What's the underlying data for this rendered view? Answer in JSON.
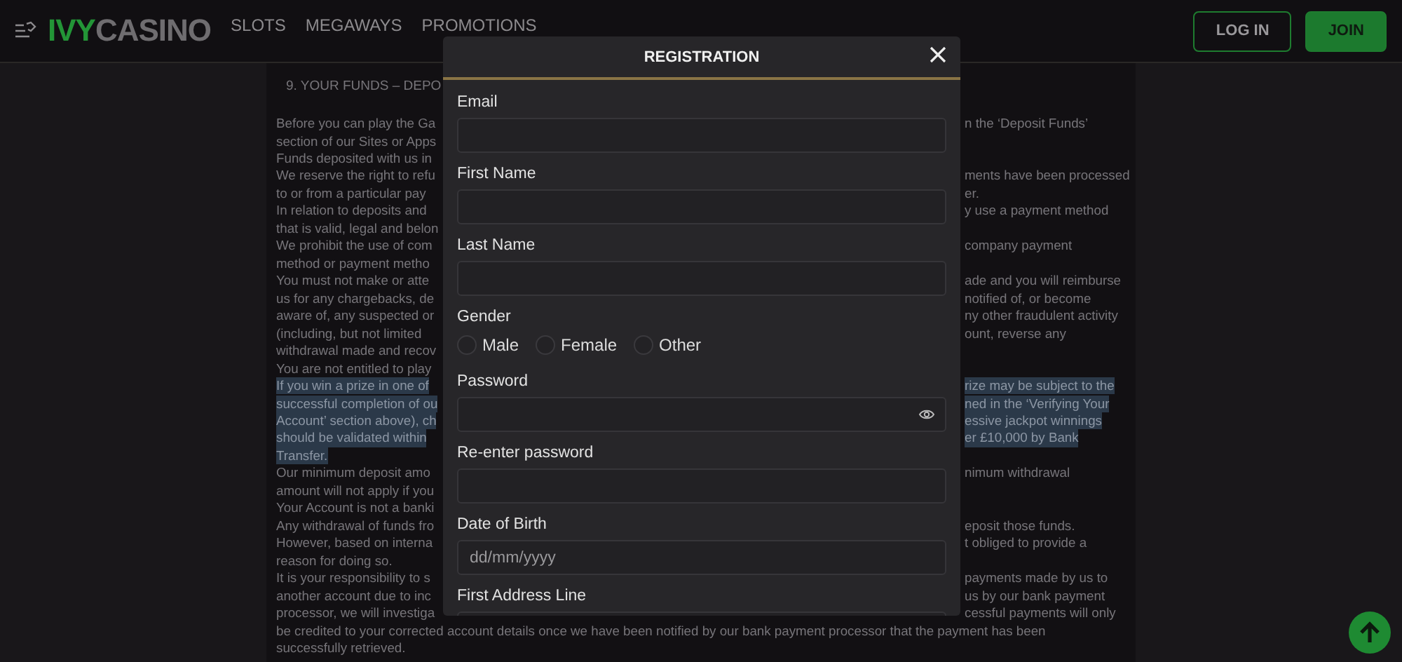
{
  "header": {
    "logo": {
      "accent": "IVY",
      "rest": "CASINO"
    },
    "nav": [
      "SLOTS",
      "MEGAWAYS",
      "PROMOTIONS"
    ],
    "buttons": [
      {
        "label": "LOG IN",
        "kind": "outline"
      },
      {
        "label": "JOIN",
        "kind": "filled"
      }
    ]
  },
  "document": {
    "heading": "9. YOUR FUNDS – DEPO",
    "lines": [
      {
        "left": "Before you can play the Ga",
        "right": "n the ‘Deposit Funds’",
        "highlighted": false
      },
      {
        "left": "section of our Sites or Apps",
        "highlighted": false
      },
      {
        "left": "Funds deposited with us in",
        "highlighted": false
      },
      {
        "left": "We reserve the right to refu",
        "right": "ments have been processed",
        "highlighted": false
      },
      {
        "left": "to or from a particular pay",
        "right": "er.",
        "highlighted": false
      },
      {
        "left": "In relation to deposits and",
        "right": "y use a payment method",
        "highlighted": false
      },
      {
        "left": "that is valid, legal and belon",
        "highlighted": false
      },
      {
        "left": "We prohibit the use of com",
        "right": "company payment",
        "highlighted": false
      },
      {
        "left": "method or payment metho",
        "highlighted": false
      },
      {
        "left": "You must not make or atte",
        "right": "ade and you will reimburse",
        "highlighted": false
      },
      {
        "left": "us for any chargebacks, de",
        "right": "notified of, or become",
        "highlighted": false
      },
      {
        "left": "aware of, any suspected or",
        "right": "ny other fraudulent activity",
        "highlighted": false
      },
      {
        "left": "(including, but not limited",
        "right": "ount, reverse any",
        "highlighted": false
      },
      {
        "left": "withdrawal made and recov",
        "highlighted": false
      },
      {
        "left": "You are not entitled to play",
        "highlighted": false
      },
      {
        "left": "If you win a prize in one of",
        "right": "rize may be subject to the",
        "highlighted": true
      },
      {
        "left": "successful completion of ou",
        "right": "ned in the ‘Verifying Your",
        "highlighted": true
      },
      {
        "left": "Account’ section above), ch",
        "right": "essive jackpot winnings",
        "highlighted": true
      },
      {
        "left": "should be validated within",
        "right": "er £10,000 by Bank",
        "highlighted": true
      },
      {
        "left": "Transfer.",
        "highlighted": true
      },
      {
        "left": "Our minimum deposit amo",
        "right": "nimum withdrawal",
        "highlighted": false
      },
      {
        "left": "amount will not apply if you",
        "highlighted": false
      },
      {
        "left": "Your Account is not a banki",
        "highlighted": false
      },
      {
        "left": "Any withdrawal of funds fro",
        "right": "eposit those funds.",
        "highlighted": false
      },
      {
        "left": "However, based on interna",
        "right": "t obliged to provide a",
        "highlighted": false
      },
      {
        "left": "reason for doing so.",
        "highlighted": false
      },
      {
        "left": "It is your responsibility to s",
        "right": "payments made by us to",
        "highlighted": false
      },
      {
        "left": "another account due to inc",
        "right": "us by our bank payment",
        "highlighted": false
      },
      {
        "left": "processor, we will investiga",
        "right": "cessful payments will only",
        "highlighted": false
      },
      {
        "text": "be credited to your corrected account details once we have been notified by our bank payment processor that the payment has been",
        "highlighted": false
      },
      {
        "text": "successfully retrieved.",
        "highlighted": false
      }
    ]
  },
  "modal": {
    "title": "REGISTRATION",
    "fields": [
      {
        "kind": "text",
        "label": "Email"
      },
      {
        "kind": "text",
        "label": "First Name"
      },
      {
        "kind": "text",
        "label": "Last Name"
      },
      {
        "kind": "radio",
        "label": "Gender",
        "options": [
          {
            "label": "Male",
            "selected": false
          },
          {
            "label": "Female",
            "selected": false
          },
          {
            "label": "Other",
            "selected": false
          }
        ]
      },
      {
        "kind": "password",
        "label": "Password"
      },
      {
        "kind": "text",
        "label": "Re-enter password"
      },
      {
        "kind": "text",
        "label": "Date of Birth",
        "placeholder": "dd/mm/yyyy"
      },
      {
        "kind": "text",
        "label": "First Address Line"
      }
    ]
  }
}
